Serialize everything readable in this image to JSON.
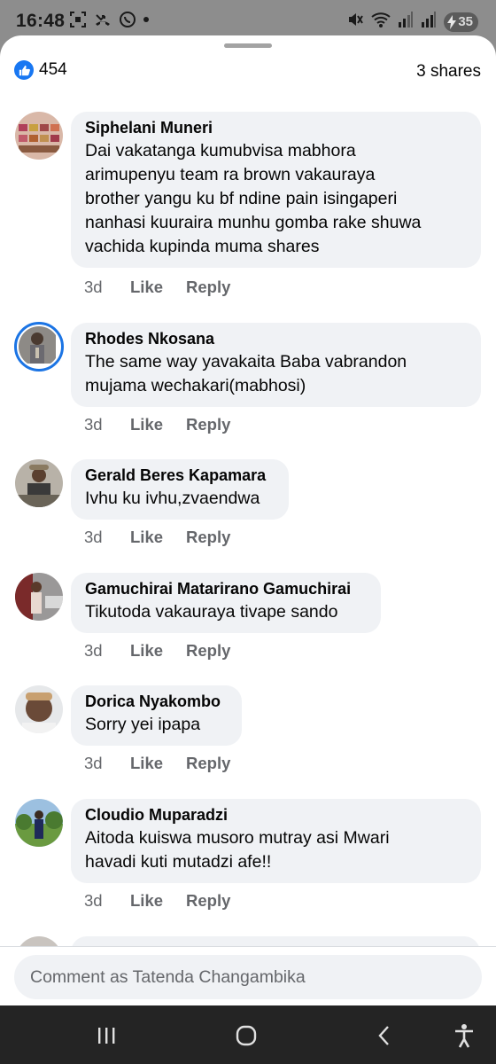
{
  "status_bar": {
    "time": "16:48",
    "battery": "35"
  },
  "post": {
    "reaction_icon": "like-icon",
    "reaction_count": "454",
    "shares": "3 shares"
  },
  "comments": [
    {
      "author": "Siphelani Muneri",
      "text": "Dai vakatanga kumubvisa mabhora\narimupenyu team ra brown vakauraya\nbrother yangu ku bf ndine pain isingaperi\nnanhasi kuuraira munhu gomba rake shuwa\nvachida kupinda muma shares",
      "time": "3d",
      "like": "Like",
      "reply": "Reply"
    },
    {
      "author": "Rhodes Nkosana",
      "text": "The same way yavakaita Baba vabrandon\nmujama wechakari(mabhosi)",
      "time": "3d",
      "like": "Like",
      "reply": "Reply"
    },
    {
      "author": "Gerald Beres Kapamara",
      "text": "Ivhu ku ivhu,zvaendwa",
      "time": "3d",
      "like": "Like",
      "reply": "Reply"
    },
    {
      "author": "Gamuchirai Matarirano Gamuchirai",
      "text": "Tikutoda vakauraya tivape sando",
      "time": "3d",
      "like": "Like",
      "reply": "Reply"
    },
    {
      "author": "Dorica Nyakombo",
      "text": "Sorry yei ipapa",
      "time": "3d",
      "like": "Like",
      "reply": "Reply"
    },
    {
      "author": "Cloudio Muparadzi",
      "text": "Aitoda kuiswa musoro mutray asi Mwari\nhavadi kuti mutadzi afe!!",
      "time": "3d",
      "like": "Like",
      "reply": "Reply"
    }
  ],
  "composer": {
    "placeholder": "Comment as Tatenda Changambika"
  },
  "nav": {
    "recents_icon": "recents-icon",
    "home_icon": "home-icon",
    "back_icon": "back-icon",
    "accessibility_icon": "accessibility-icon"
  },
  "colors": {
    "accent": "#1877f2",
    "bubble": "#f0f2f5",
    "secondary_text": "#65676b"
  }
}
